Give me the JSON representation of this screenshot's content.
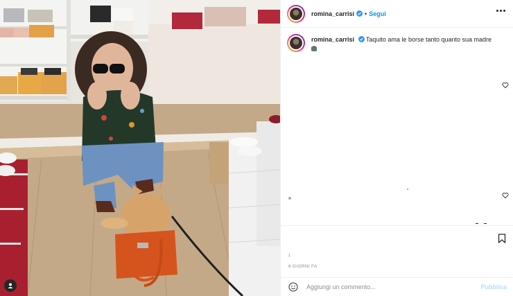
{
  "post": {
    "username": "romina_carrisi",
    "verified": true,
    "separator": "•",
    "follow_label": "Segui",
    "caption": "Taquito ama le borse tanto quanto sua madre",
    "caption_emoji_icon": "shopping-bag-emoji-icon",
    "small_mark": "1",
    "date": "6 GIORNI FA",
    "comment_placeholder": "Aggiungi un commento...",
    "publish_label": "Pubblica"
  },
  "photo": {
    "description_icons": [
      "user-tag-icon"
    ]
  },
  "colors": {
    "follow_blue": "#0095f6",
    "publish_disabled": "#b2dffc",
    "verified_blue": "#3897f0",
    "bag_orange": "#d5541d"
  }
}
